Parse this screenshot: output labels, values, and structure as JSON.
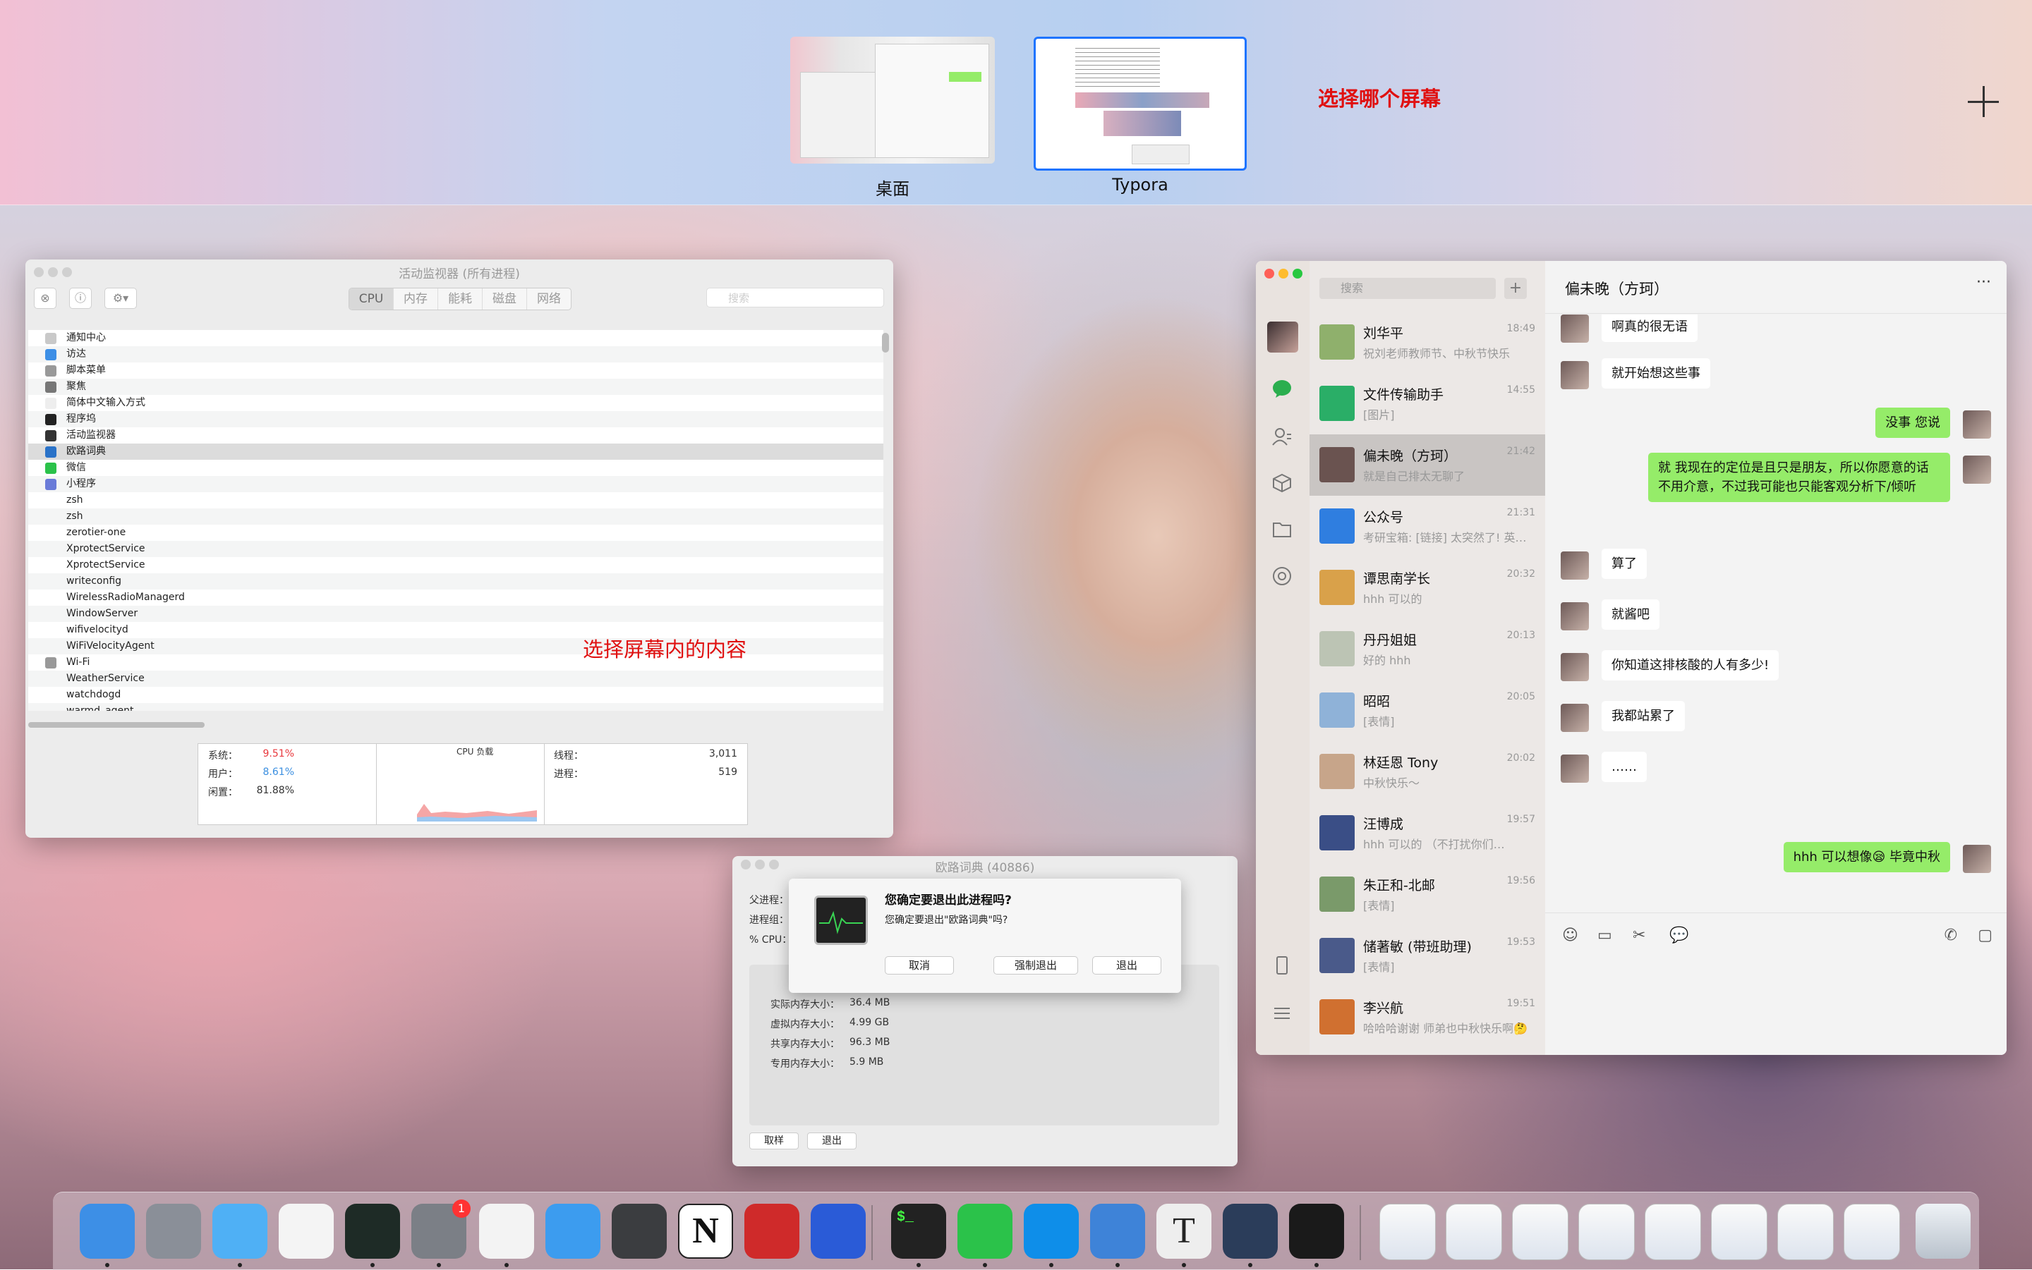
{
  "mission_control": {
    "spaces": [
      {
        "label": "桌面"
      },
      {
        "label": "Typora"
      }
    ],
    "hint": "选择哪个屏幕",
    "add_label": "+"
  },
  "activity_monitor": {
    "title": "活动监视器 (所有进程)",
    "tabs": [
      "CPU",
      "内存",
      "能耗",
      "磁盘",
      "网络"
    ],
    "active_tab": "CPU",
    "search_placeholder": "搜索",
    "processes": [
      "通知中心",
      "访达",
      "脚本菜单",
      "聚焦",
      "简体中文输入方式",
      "程序坞",
      "活动监视器",
      "欧路词典",
      "微信",
      "小程序",
      "zsh",
      "zsh",
      "zerotier-one",
      "XprotectService",
      "XprotectService",
      "writeconfig",
      "WirelessRadioManagerd",
      "WindowServer",
      "wifivelocityd",
      "WiFiVelocityAgent",
      "Wi-Fi",
      "WeatherService",
      "watchdogd",
      "warmd_agent"
    ],
    "selected_process": "欧路词典",
    "hint": "选择屏幕内的内容",
    "stats": {
      "system_label": "系统：",
      "system_value": "9.51%",
      "user_label": "用户：",
      "user_value": "8.61%",
      "idle_label": "闲置：",
      "idle_value": "81.88%",
      "load_label": "CPU 负载",
      "threads_label": "线程：",
      "threads_value": "3,011",
      "procs_label": "进程：",
      "procs_value": "519"
    },
    "colors": {
      "system": "#e8383d",
      "user": "#3b8fe0"
    }
  },
  "process_window": {
    "title": "欧路词典 (40886)",
    "labels": [
      "父进程：",
      "进程组：",
      "% CPU："
    ],
    "memory": [
      {
        "k": "实际内存大小：",
        "v": "36.4 MB"
      },
      {
        "k": "虚拟内存大小：",
        "v": "4.99 GB"
      },
      {
        "k": "共享内存大小：",
        "v": "96.3 MB"
      },
      {
        "k": "专用内存大小：",
        "v": "5.9 MB"
      }
    ],
    "buttons": [
      "取样",
      "退出"
    ]
  },
  "quit_dialog": {
    "title": "您确定要退出此进程吗?",
    "message": "您确定要退出\"欧路词典\"吗?",
    "cancel": "取消",
    "force_quit": "强制退出",
    "quit": "退出"
  },
  "wechat": {
    "search_placeholder": "搜索",
    "add": "+",
    "chat_title": "偏未晚（方珂）",
    "more": "···",
    "conversations": [
      {
        "name": "刘华平",
        "time": "18:49",
        "preview": "祝刘老师教师节、中秋节快乐",
        "color": "#8fb06c"
      },
      {
        "name": "文件传输助手",
        "time": "14:55",
        "preview": "[图片]",
        "color": "#2aae67"
      },
      {
        "name": "偏未晚（方珂）",
        "time": "21:42",
        "preview": "就是自己排太无聊了",
        "color": "#6a5350"
      },
      {
        "name": "公众号",
        "time": "21:31",
        "preview": "考研宝箱: [链接] 太突然了! 英…",
        "color": "#2f7ee0"
      },
      {
        "name": "谭思南学长",
        "time": "20:32",
        "preview": "hhh 可以的",
        "color": "#d9a14a"
      },
      {
        "name": "丹丹姐姐",
        "time": "20:13",
        "preview": "好的 hhh",
        "color": "#bcc4b4"
      },
      {
        "name": "昭昭",
        "time": "20:05",
        "preview": "[表情]",
        "color": "#8fb2d8"
      },
      {
        "name": "林廷恩 Tony",
        "time": "20:02",
        "preview": "中秋快乐～",
        "color": "#c7a58a"
      },
      {
        "name": "汪博成",
        "time": "19:57",
        "preview": "hhh 可以的 （不打扰你们…",
        "color": "#3a4e86"
      },
      {
        "name": "朱正和-北邮",
        "time": "19:56",
        "preview": "[表情]",
        "color": "#7a9a6a"
      },
      {
        "name": "储著敏 (带班助理)",
        "time": "19:53",
        "preview": "[表情]",
        "color": "#4a5a8a"
      },
      {
        "name": "李兴航",
        "time": "19:51",
        "preview": "哈哈哈谢谢 师弟也中秋快乐啊🤔",
        "color": "#d07030"
      }
    ],
    "messages": [
      {
        "side": "l",
        "text": "啊真的很无语"
      },
      {
        "side": "l",
        "text": "就开始想这些事"
      },
      {
        "side": "r",
        "text": "没事 您说"
      },
      {
        "side": "r",
        "text": "就 我现在的定位是且只是朋友，所以你愿意的话不用介意，不过我可能也只能客观分析下/倾听"
      },
      {
        "side": "l",
        "text": "算了"
      },
      {
        "side": "l",
        "text": "就酱吧"
      },
      {
        "side": "l",
        "text": "你知道这排核酸的人有多少!"
      },
      {
        "side": "l",
        "text": "我都站累了"
      },
      {
        "side": "l",
        "text": "……"
      },
      {
        "side": "r",
        "text": "hhh 可以想像😪 毕竟中秋"
      },
      {
        "side": "r",
        "text": "就是自己排太无聊了"
      }
    ]
  },
  "dock": {
    "apps": [
      {
        "name": "finder-icon",
        "color": "#3d8fe6"
      },
      {
        "name": "launchpad-icon",
        "color": "#8a8f98"
      },
      {
        "name": "messages-icon",
        "color": "#4fb0f5"
      },
      {
        "name": "reminders-icon",
        "color": "#f4f4f4"
      },
      {
        "name": "pycharm-icon",
        "color": "#1e2b26"
      },
      {
        "name": "system-preferences-icon",
        "color": "#7b7f86"
      },
      {
        "name": "chrome-icon",
        "color": "#f3f3f3"
      },
      {
        "name": "safari-icon",
        "color": "#3c9cef"
      },
      {
        "name": "sublime-icon",
        "color": "#3b3d40"
      },
      {
        "name": "notion-icon",
        "color": "#ffffff"
      },
      {
        "name": "zotero-icon",
        "color": "#cf2a2a"
      },
      {
        "name": "omnifocus-icon",
        "color": "#2a5bd7"
      },
      {
        "name": "terminal-icon",
        "color": "#222222"
      },
      {
        "name": "wechat-icon",
        "color": "#2bc24a"
      },
      {
        "name": "teamviewer-icon",
        "color": "#0e8ee9"
      },
      {
        "name": "dictionary-icon",
        "color": "#3e83d8"
      },
      {
        "name": "typora-icon",
        "color": "#eeeeee"
      },
      {
        "name": "quicktime-icon",
        "color": "#2b3d5a"
      },
      {
        "name": "activity-monitor-icon",
        "color": "#1a1a1a"
      }
    ],
    "badge": "1",
    "notion_glyph": "N",
    "typora_glyph": "T",
    "terminal_glyph": "$_"
  }
}
